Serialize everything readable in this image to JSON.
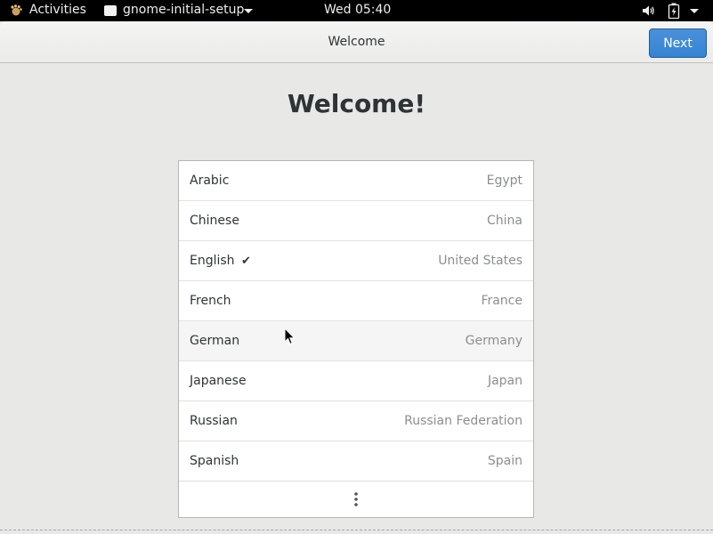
{
  "topbar": {
    "activities": "Activities",
    "app_name": "gnome-initial-setup",
    "clock": "Wed 05:40",
    "icons": [
      "gnome-foot-icon",
      "window-icon",
      "volume-icon",
      "battery-icon",
      "chevron-down-icon"
    ]
  },
  "header": {
    "title": "Welcome",
    "next_label": "Next",
    "accent": "#3584d4"
  },
  "main": {
    "heading": "Welcome!",
    "languages": [
      {
        "name": "Arabic",
        "region": "Egypt"
      },
      {
        "name": "Chinese",
        "region": "China"
      },
      {
        "name": "English",
        "region": "United States",
        "selected": true,
        "check": "✔"
      },
      {
        "name": "French",
        "region": "France"
      },
      {
        "name": "German",
        "region": "Germany",
        "hovered": true
      },
      {
        "name": "Japanese",
        "region": "Japan"
      },
      {
        "name": "Russian",
        "region": "Russian Federation"
      },
      {
        "name": "Spanish",
        "region": "Spain"
      }
    ],
    "more_icon": "view-more-icon"
  }
}
